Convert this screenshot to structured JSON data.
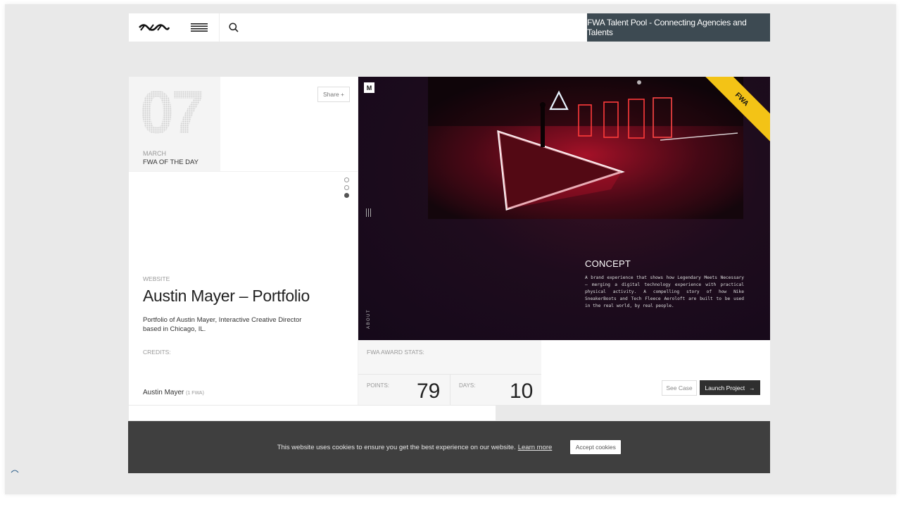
{
  "header": {
    "logo_text": "FWA",
    "talent_pool_label": "FWA Talent Pool - Connecting Agencies and Talents"
  },
  "day": {
    "number": "07",
    "month": "MARCH",
    "label": "FWA OF THE DAY",
    "share_label": "Share +"
  },
  "project": {
    "category": "WEBSITE",
    "title": "Austin Mayer – Portfolio",
    "description": "Portfolio of Austin Mayer, Interactive Creative Director based in Chicago, IL."
  },
  "hero": {
    "badge": "M",
    "ribbon_text": "FWA",
    "side_label": "ABOUT",
    "concept_title": "CONCEPT",
    "concept_text": "A brand experience that shows how Legendary Meets Necessary – merging a digital technology experience with practical physical activity. A compelling story of how Nike SneakerBoots and Tech Fleece Aeroloft are built to be used in the real world, by real people."
  },
  "credits": {
    "label": "CREDITS:",
    "name": "Austin Mayer",
    "count": "(1 FWA)"
  },
  "stats": {
    "label": "FWA AWARD STATS:",
    "points_label": "POINTS:",
    "points_value": "79",
    "days_label": "DAYS:",
    "days_value": "10"
  },
  "actions": {
    "see_case": "See Case",
    "launch": "Launch Project",
    "launch_arrow": "→"
  },
  "cookie": {
    "text": "This website uses cookies to ensure you get the best experience on our website.",
    "link": "Learn more",
    "accept": "Accept cookies"
  },
  "colors": {
    "talent_bg": "#3d4a52",
    "ribbon": "#f3c316",
    "cookie_bg": "#3f3f3f",
    "launch_bg": "#2f2f2f"
  }
}
